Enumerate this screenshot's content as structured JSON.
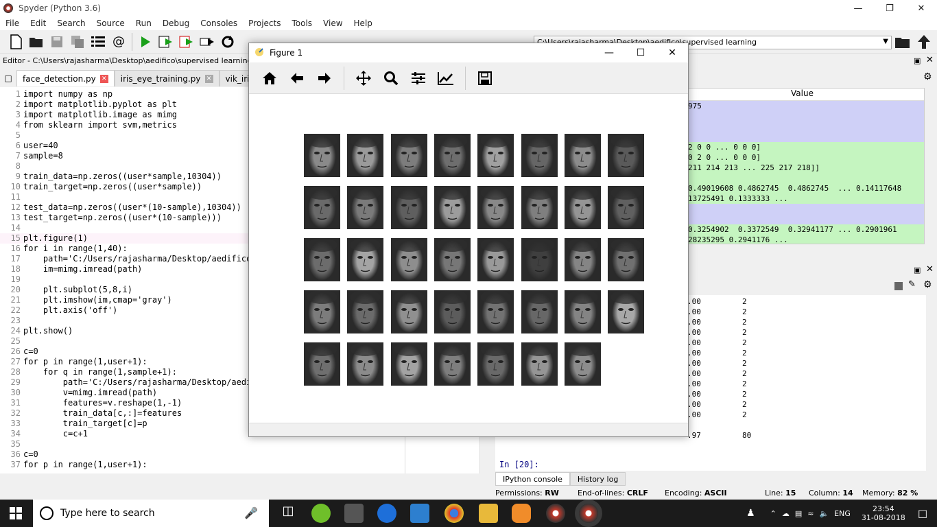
{
  "window": {
    "title": "Spyder (Python 3.6)"
  },
  "menubar": [
    "File",
    "Edit",
    "Search",
    "Source",
    "Run",
    "Debug",
    "Consoles",
    "Projects",
    "Tools",
    "View",
    "Help"
  ],
  "toolbar": {
    "path": "C:\\Users\\rajasharma\\Desktop\\aedifico\\supervised learning"
  },
  "editor": {
    "title": "Editor - C:\\Users\\rajasharma\\Desktop\\aedifico\\supervised learning\\face_d",
    "tabs": [
      "face_detection.py",
      "iris_eye_training.py",
      "vik_iris.py"
    ],
    "lines": [
      {
        "n": "1",
        "t": "import numpy as np"
      },
      {
        "n": "2",
        "t": "import matplotlib.pyplot as plt"
      },
      {
        "n": "3",
        "t": "import matplotlib.image as mimg"
      },
      {
        "n": "4",
        "t": "from sklearn import svm,metrics"
      },
      {
        "n": "5",
        "t": ""
      },
      {
        "n": "6",
        "t": "user=40"
      },
      {
        "n": "7",
        "t": "sample=8"
      },
      {
        "n": "8",
        "t": ""
      },
      {
        "n": "9",
        "t": "train_data=np.zeros((user*sample,10304))"
      },
      {
        "n": "10",
        "t": "train_target=np.zeros((user*sample))"
      },
      {
        "n": "11",
        "t": ""
      },
      {
        "n": "12",
        "t": "test_data=np.zeros((user*(10-sample),10304))"
      },
      {
        "n": "13",
        "t": "test_target=np.zeros((user*(10-sample)))"
      },
      {
        "n": "14",
        "t": ""
      },
      {
        "n": "15",
        "t": "plt.figure(1)"
      },
      {
        "n": "16",
        "t": "for i in range(1,40):"
      },
      {
        "n": "17",
        "t": "    path='C:/Users/rajasharma/Desktop/aedifico/"
      },
      {
        "n": "18",
        "t": "    im=mimg.imread(path)"
      },
      {
        "n": "19",
        "t": ""
      },
      {
        "n": "20",
        "t": "    plt.subplot(5,8,i)"
      },
      {
        "n": "21",
        "t": "    plt.imshow(im,cmap='gray')"
      },
      {
        "n": "22",
        "t": "    plt.axis('off')"
      },
      {
        "n": "23",
        "t": ""
      },
      {
        "n": "24",
        "t": "plt.show()"
      },
      {
        "n": "25",
        "t": ""
      },
      {
        "n": "26",
        "t": "c=0"
      },
      {
        "n": "27",
        "t": "for p in range(1,user+1):"
      },
      {
        "n": "28",
        "t": "    for q in range(1,sample+1):"
      },
      {
        "n": "29",
        "t": "        path='C:/Users/rajasharma/Desktop/aedif"
      },
      {
        "n": "30",
        "t": "        v=mimg.imread(path)"
      },
      {
        "n": "31",
        "t": "        features=v.reshape(1,-1)"
      },
      {
        "n": "32",
        "t": "        train_data[c,:]=features"
      },
      {
        "n": "33",
        "t": "        train_target[c]=p"
      },
      {
        "n": "34",
        "t": "        c=c+1"
      },
      {
        "n": "35",
        "t": ""
      },
      {
        "n": "36",
        "t": "c=0"
      },
      {
        "n": "37",
        "t": "for p in range(1,user+1):"
      }
    ]
  },
  "variables": {
    "header": "Value",
    "rows": [
      {
        "text": "975",
        "color": "#cfd0f7"
      },
      {
        "text": "",
        "color": "#cfd0f7"
      },
      {
        "text": "2 0 0 ... 0 0 0]\n0 2 0 ... 0 0 0]",
        "color": "#c5f5c0"
      },
      {
        "text": "211 214 213 ... 225 217 218]]",
        "color": "#c5f5c0"
      },
      {
        "text": "0.49019608 0.4862745  0.4862745  ... 0.14117648\n13725491 0.1333333 ...",
        "color": "#c5f5c0"
      },
      {
        "text": "",
        "color": "#cfd0f7"
      },
      {
        "text": "0.3254902  0.3372549  0.32941177 ... 0.2901961\n28235295 0.2941176 ...",
        "color": "#c5f5c0"
      }
    ]
  },
  "console": {
    "rows": [
      {
        "a": ".00",
        "b": "2"
      },
      {
        "a": ".00",
        "b": "2"
      },
      {
        "a": ".00",
        "b": "2"
      },
      {
        "a": ".00",
        "b": "2"
      },
      {
        "a": ".00",
        "b": "2"
      },
      {
        "a": ".00",
        "b": "2"
      },
      {
        "a": ".00",
        "b": "2"
      },
      {
        "a": ".00",
        "b": "2"
      },
      {
        "a": ".00",
        "b": "2"
      },
      {
        "a": ".00",
        "b": "2"
      },
      {
        "a": ".00",
        "b": "2"
      },
      {
        "a": ".00",
        "b": "2"
      },
      {
        "a": "",
        "b": ""
      },
      {
        "a": ".97",
        "b": "80"
      }
    ],
    "prompt": "In [20]:",
    "tabs": [
      "IPython console",
      "History log"
    ]
  },
  "status": {
    "permissions_label": "Permissions:",
    "permissions": "RW",
    "eol_label": "End-of-lines:",
    "eol": "CRLF",
    "encoding_label": "Encoding:",
    "encoding": "ASCII",
    "line_label": "Line:",
    "line": "15",
    "col_label": "Column:",
    "col": "14",
    "mem_label": "Memory:",
    "mem": "82 %"
  },
  "figure": {
    "title": "Figure 1",
    "faces": [
      {
        "tone": "#8a8a8a"
      },
      {
        "tone": "#9a9a9a"
      },
      {
        "tone": "#7d7d7d"
      },
      {
        "tone": "#6e6e6e"
      },
      {
        "tone": "#a0a0a0"
      },
      {
        "tone": "#666666"
      },
      {
        "tone": "#8c8c8c"
      },
      {
        "tone": "#5a5a5a"
      },
      {
        "tone": "#6a6a6a"
      },
      {
        "tone": "#7a7a7a"
      },
      {
        "tone": "#5f5f5f"
      },
      {
        "tone": "#9c9c9c"
      },
      {
        "tone": "#888888"
      },
      {
        "tone": "#7f7f7f"
      },
      {
        "tone": "#959595"
      },
      {
        "tone": "#606060"
      },
      {
        "tone": "#6c6c6c"
      },
      {
        "tone": "#a4a4a4"
      },
      {
        "tone": "#8e8e8e"
      },
      {
        "tone": "#777777"
      },
      {
        "tone": "#999999"
      },
      {
        "tone": "#3f3f3f"
      },
      {
        "tone": "#858585"
      },
      {
        "tone": "#707070"
      },
      {
        "tone": "#7c7c7c"
      },
      {
        "tone": "#6b6b6b"
      },
      {
        "tone": "#909090"
      },
      {
        "tone": "#5c5c5c"
      },
      {
        "tone": "#727272"
      },
      {
        "tone": "#676767"
      },
      {
        "tone": "#848484"
      },
      {
        "tone": "#a8a8a8"
      },
      {
        "tone": "#6f6f6f"
      },
      {
        "tone": "#8b8b8b"
      },
      {
        "tone": "#a3a3a3"
      },
      {
        "tone": "#7e7e7e"
      },
      {
        "tone": "#696969"
      },
      {
        "tone": "#959595"
      },
      {
        "tone": "#8d8d8d"
      }
    ]
  },
  "taskbar": {
    "search_placeholder": "Type here to search",
    "lang": "ENG",
    "time": "23:54",
    "date": "31-08-2018"
  }
}
